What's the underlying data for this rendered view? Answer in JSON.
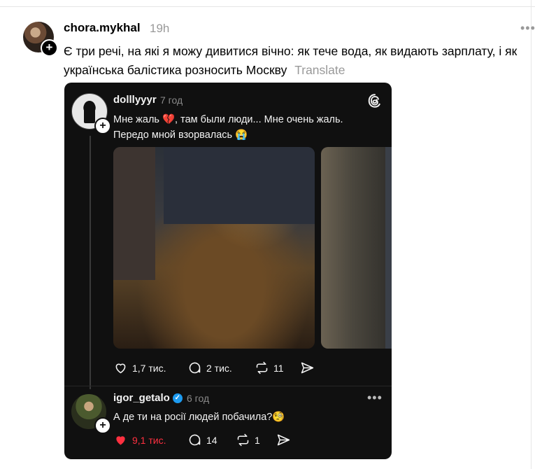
{
  "post": {
    "username": "chora.mykhal",
    "time": "19h",
    "text": "Є три речі, на які я можу дивитися вічно: як тече вода, як видають зарплату, і як українська балістика розносить Москву",
    "translate_label": "Translate"
  },
  "quoted": {
    "username": "dolllyyyr",
    "time": "7 год",
    "text": "Мне жаль 💔, там были люди... Мне очень жаль. Передо мной взорвалась 😭",
    "actions": {
      "likes": "1,7 тис.",
      "comments": "2 тис.",
      "reposts": "11"
    }
  },
  "reply": {
    "username": "igor_getalo",
    "time": "6 год",
    "text": "А де ти на росії людей побачила?🧐",
    "actions": {
      "likes": "9,1 тис.",
      "comments": "14",
      "reposts": "1"
    }
  },
  "colors": {
    "card_bg": "#101010",
    "like_active": "#ff3040",
    "verified": "#1d9bf0",
    "muted": "#999999"
  },
  "icons": [
    "plus-icon",
    "more-icon",
    "threads-logo-icon",
    "heart-icon",
    "comment-icon",
    "repost-icon",
    "share-icon",
    "verified-icon"
  ]
}
